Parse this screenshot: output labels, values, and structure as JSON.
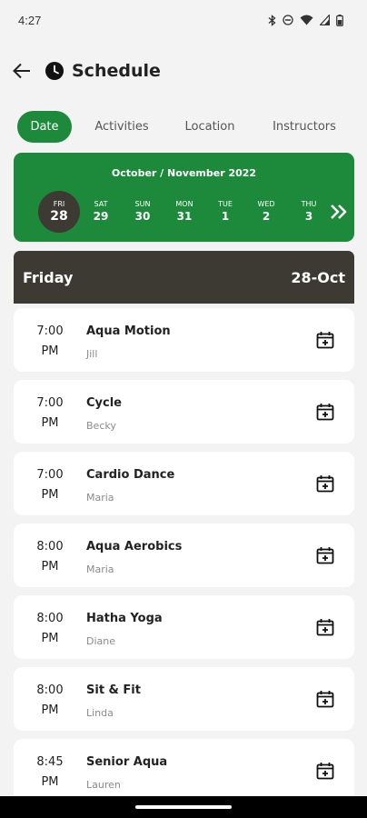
{
  "status_bar": {
    "time": "4:27"
  },
  "header": {
    "title": "Schedule"
  },
  "tabs": [
    {
      "label": "Date",
      "active": true
    },
    {
      "label": "Activities",
      "active": false
    },
    {
      "label": "Location",
      "active": false
    },
    {
      "label": "Instructors",
      "active": false
    }
  ],
  "calendar": {
    "month_label": "October / November 2022",
    "days": [
      {
        "name": "FRI",
        "num": "28",
        "selected": true
      },
      {
        "name": "SAT",
        "num": "29"
      },
      {
        "name": "SUN",
        "num": "30"
      },
      {
        "name": "MON",
        "num": "31"
      },
      {
        "name": "TUE",
        "num": "1"
      },
      {
        "name": "WED",
        "num": "2"
      },
      {
        "name": "THU",
        "num": "3"
      }
    ]
  },
  "date_header": {
    "day": "Friday",
    "date": "28-Oct"
  },
  "classes": [
    {
      "time": "7:00",
      "period": "PM",
      "name": "Aqua Motion",
      "instructor": "Jill"
    },
    {
      "time": "7:00",
      "period": "PM",
      "name": "Cycle",
      "instructor": "Becky"
    },
    {
      "time": "7:00",
      "period": "PM",
      "name": "Cardio Dance",
      "instructor": "Maria"
    },
    {
      "time": "8:00",
      "period": "PM",
      "name": "Aqua Aerobics",
      "instructor": "Maria"
    },
    {
      "time": "8:00",
      "period": "PM",
      "name": "Hatha Yoga",
      "instructor": "Diane"
    },
    {
      "time": "8:00",
      "period": "PM",
      "name": "Sit & Fit",
      "instructor": "Linda"
    },
    {
      "time": "8:45",
      "period": "PM",
      "name": "Senior Aqua",
      "instructor": "Lauren"
    }
  ],
  "colors": {
    "accent": "#1d8a3b",
    "dark": "#3d3933",
    "background": "#f3f3f3"
  },
  "icons": {
    "back": "arrow-left-icon",
    "title": "clock-icon",
    "next": "double-chevron-right-icon",
    "add": "calendar-plus-icon"
  }
}
